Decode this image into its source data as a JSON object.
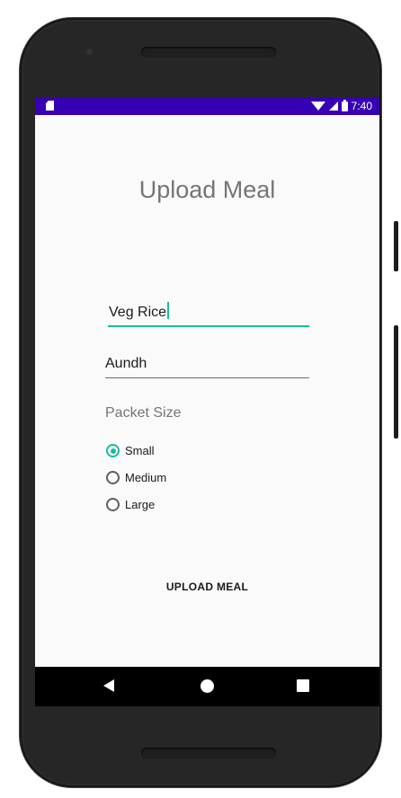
{
  "status_bar": {
    "time": "7:40",
    "icons": [
      "sd-card-icon",
      "wifi-icon",
      "signal-icon",
      "battery-icon"
    ],
    "background_color": "#3700b3"
  },
  "page": {
    "title": "Upload Meal"
  },
  "form": {
    "meal_name_value": "Veg Rice",
    "location_value": "Aundh",
    "packet_size_label": "Packet Size",
    "packet_sizes": [
      {
        "label": "Small",
        "checked": true
      },
      {
        "label": "Medium",
        "checked": false
      },
      {
        "label": "Large",
        "checked": false
      }
    ],
    "accent_color": "#1abc9c"
  },
  "actions": {
    "upload_label": "UPLOAD MEAL"
  },
  "nav_bar": {
    "icons": [
      "back-icon",
      "home-icon",
      "recents-icon"
    ]
  }
}
